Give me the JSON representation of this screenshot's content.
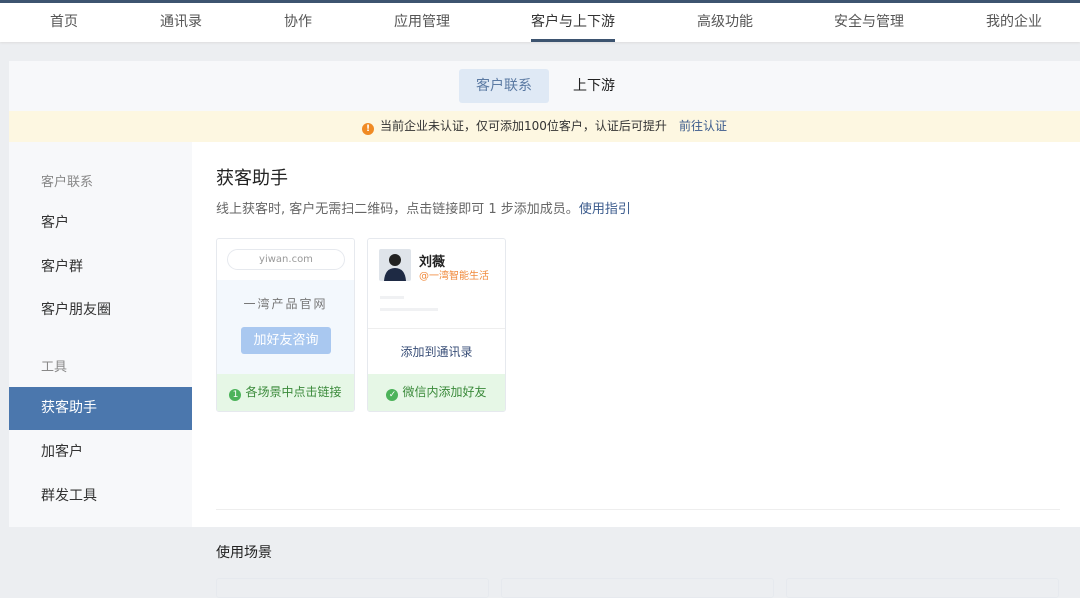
{
  "topnav": [
    "首页",
    "通讯录",
    "协作",
    "应用管理",
    "客户与上下游",
    "高级功能",
    "安全与管理",
    "我的企业"
  ],
  "tabs": [
    "客户联系",
    "上下游"
  ],
  "banner": {
    "text": "当前企业未认证，仅可添加100位客户，认证后可提升",
    "link": "前往认证",
    "icon": "!"
  },
  "sidebar": {
    "group1": "客户联系",
    "items1": [
      "客户",
      "客户群",
      "客户朋友圈"
    ],
    "group2": "工具",
    "items2": [
      "获客助手",
      "加客户",
      "群发工具"
    ]
  },
  "main": {
    "title": "获客助手",
    "subtitle": "线上获客时, 客户无需扫二维码，点击链接即可 1 步添加成员。",
    "guide": "使用指引",
    "card1": {
      "url": "yiwan.com",
      "site": "一湾产品官网",
      "button": "加好友咨询",
      "step": "1",
      "footer": "各场景中点击链接"
    },
    "card2": {
      "name": "刘薇",
      "org": "@一湾智能生活",
      "add": "添加到通讯录",
      "footer": "微信内添加好友"
    },
    "section": "使用场景"
  }
}
